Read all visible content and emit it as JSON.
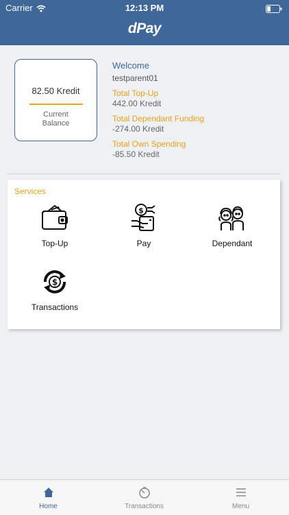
{
  "status_bar": {
    "carrier": "Carrier",
    "time": "12:13 PM"
  },
  "header": {
    "logo": "dPay"
  },
  "balance": {
    "amount": "82.50 Kredit",
    "label_line1": "Current",
    "label_line2": "Balance"
  },
  "summary": {
    "welcome": "Welcome",
    "username": "testparent01",
    "total_topup_label": "Total Top-Up",
    "total_topup_value": "442.00 Kredit",
    "dependant_funding_label": "Total Dependant Funding",
    "dependant_funding_value": "-274.00 Kredit",
    "own_spending_label": "Total Own Spending",
    "own_spending_value": "-85.50 Kredit"
  },
  "services": {
    "title": "Services",
    "items": [
      {
        "label": "Top-Up",
        "icon": "wallet-icon"
      },
      {
        "label": "Pay",
        "icon": "pay-icon"
      },
      {
        "label": "Dependant",
        "icon": "children-icon"
      },
      {
        "label": "Transactions",
        "icon": "transactions-icon"
      }
    ]
  },
  "tabs": [
    {
      "label": "Home",
      "icon": "home-icon",
      "active": true
    },
    {
      "label": "Transactions",
      "icon": "timer-icon",
      "active": false
    },
    {
      "label": "Menu",
      "icon": "menu-icon",
      "active": false
    }
  ],
  "colors": {
    "primary": "#3f6899",
    "accent": "#e8a317"
  }
}
